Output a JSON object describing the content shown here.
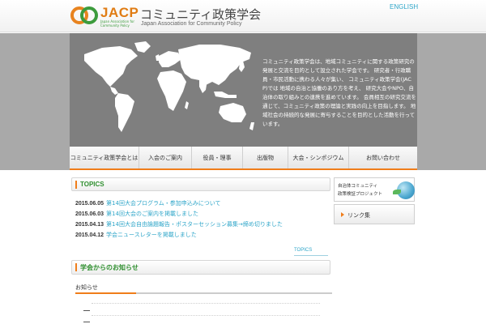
{
  "header": {
    "logo_acronym": "JACP",
    "logo_subtitle": "Japan Association for Community Policy",
    "site_title": "コミュニティ政策学会",
    "site_subtitle": "Japan Association for Community Policy",
    "english_link": "ENGLISH"
  },
  "hero": {
    "text": "コミュニティ政策学会は、地域コミュニティに関する政策研究の発展と交流を目的として設立された学会です。 研究者・行政職員・市民活動に携わる人々が集い、 コミュニティ政策学会(JACP)では 地域の自治と協働のあり方を考え、 研究大会やNPO、自治体の取り組みとの連携を進めています。 会員相互の研究交流を通じて、コミュニティ政策の理論と実践の向上を目指します。 地域社会の持続的な発展に寄与することを目的とした活動を行っています。"
  },
  "nav": {
    "items": [
      "コミュニティ政策学会とは",
      "入会のご案内",
      "役員・理事",
      "出版物",
      "大会・シンポジウム",
      "お問い合わせ"
    ]
  },
  "topics": {
    "title": "TOPICS",
    "items": [
      {
        "date": "2015.06.05",
        "text": "第14回大会プログラム・参加申込みについて"
      },
      {
        "date": "2015.06.03",
        "text": "第14回大会のご案内を掲載しました"
      },
      {
        "date": "2015.04.13",
        "text": "第14回大会自由論題報告・ポスターセッション募集→締め切りました"
      },
      {
        "date": "2015.04.12",
        "text": "学会ニュースレターを掲載しました"
      }
    ],
    "more_link": "TOPICS"
  },
  "news": {
    "title": "学会からのお知らせ",
    "subtitle": "お知らせ"
  },
  "sidebar": {
    "banner_line1": "自治体コミュニティ",
    "banner_line2": "政策検証プロジェクト",
    "link_label": "リンク集"
  },
  "colors": {
    "accent_orange": "#f07d1a",
    "accent_green": "#2f8f2f",
    "link_blue": "#2fa6c9",
    "hero_gray": "#7f7f7f"
  }
}
